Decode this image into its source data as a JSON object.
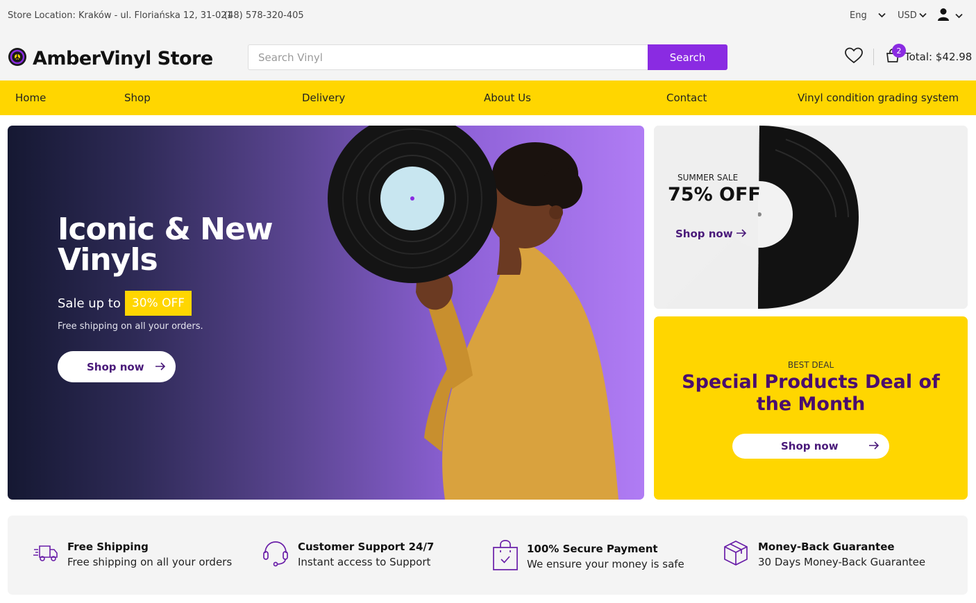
{
  "topbar": {
    "location": "Store Location: Kraków - ul. Floriańska 12, 31-021",
    "phone": "(48) 578-320-405",
    "language": "Eng",
    "currency": "USD"
  },
  "header": {
    "brand": "AmberVinyl Store",
    "search_placeholder": "Search Vinyl",
    "search_button": "Search",
    "cart_count": "2",
    "cart_total": "Total: $42.98"
  },
  "nav": {
    "items": [
      "Home",
      "Shop",
      "Delivery",
      "About Us",
      "Contact",
      "Vinyl condition grading system"
    ]
  },
  "hero": {
    "title_line1": "Iconic & New",
    "title_line2": "Vinyls",
    "sale_prefix": "Sale up to",
    "sale_percent": "30% OFF",
    "subtitle": "Free shipping on all your orders.",
    "cta": "Shop now"
  },
  "summer": {
    "label": "SUMMER SALE",
    "discount": "75% OFF",
    "cta": "Shop now"
  },
  "deal": {
    "label": "BEST DEAL",
    "title": "Special Products Deal of the Month",
    "cta": "Shop now"
  },
  "features": [
    {
      "title": "Free Shipping",
      "desc": "Free shipping on all your orders",
      "icon": "truck-icon"
    },
    {
      "title": "Customer Support 24/7",
      "desc": "Instant access to Support",
      "icon": "headset-icon"
    },
    {
      "title": "100% Secure Payment",
      "desc": "We ensure your money is safe",
      "icon": "shopping-bag-icon"
    },
    {
      "title": "Money-Back Guarantee",
      "desc": "30 Days Money-Back Guarantee",
      "icon": "box-icon"
    }
  ],
  "colors": {
    "accent": "#8a2be2",
    "brand_yellow": "#ffd600",
    "deep_purple": "#4a0d6e"
  }
}
